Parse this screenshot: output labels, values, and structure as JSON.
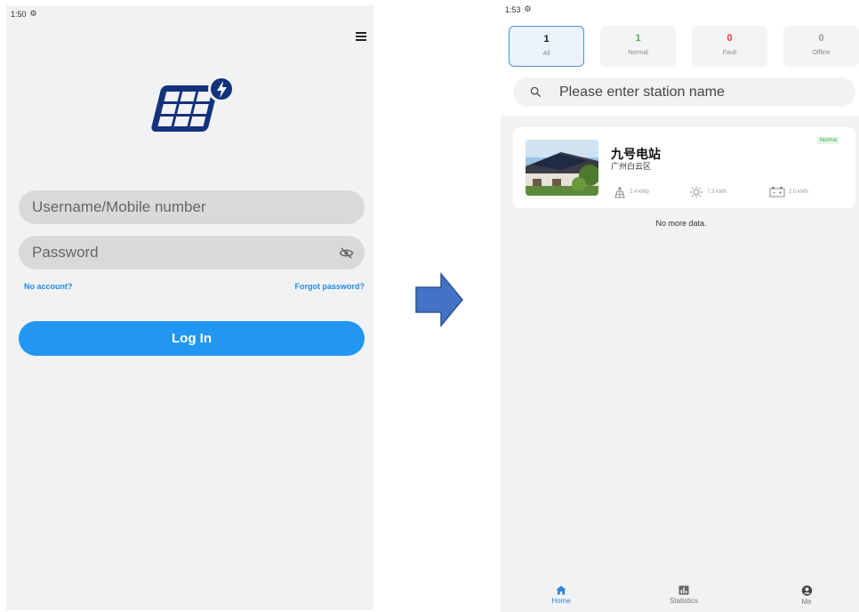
{
  "login": {
    "status_time": "1:50",
    "username_placeholder": "Username/Mobile number",
    "password_placeholder": "Password",
    "no_account": "No account?",
    "forgot_password": "Forgot password?",
    "login_button": "Log In"
  },
  "home": {
    "status_time": "1:53",
    "tabs": [
      {
        "count": "1",
        "label": "All",
        "count_color": "#111111"
      },
      {
        "count": "1",
        "label": "Normal",
        "count_color": "#4caf50"
      },
      {
        "count": "0",
        "label": "Fault",
        "count_color": "#e53935"
      },
      {
        "count": "0",
        "label": "Offline",
        "count_color": "#999999"
      }
    ],
    "search_placeholder": "Please enter station name",
    "station": {
      "name": "九号电站",
      "location": "广州白云区",
      "status": "Normal",
      "capacity": "2.4 kWp",
      "power": "7.3 kWh",
      "energy": "2.0 kWh"
    },
    "no_more": "No more data.",
    "bottom_tabs": [
      "Home",
      "Statistics",
      "Me"
    ]
  },
  "colors": {
    "accent": "#2196f3",
    "logo": "#13337a",
    "arrow": "#4472c4",
    "normal": "#4caf50",
    "fault": "#e53935"
  },
  "icons": [
    "settings-icon",
    "menu-icon",
    "solar-logo-icon",
    "eye-off-icon",
    "search-icon",
    "solar-panel-icon",
    "sun-icon",
    "battery-icon",
    "home-icon",
    "statistics-icon",
    "profile-icon"
  ]
}
